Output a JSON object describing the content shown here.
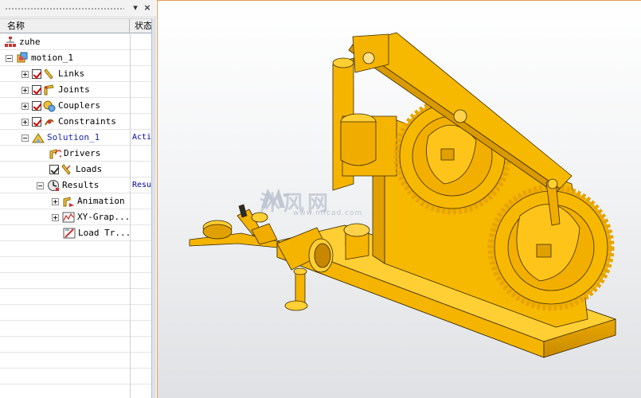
{
  "navigator": {
    "columns": {
      "name": "名称",
      "status": "状态"
    },
    "items": [
      {
        "label": "zuhe",
        "status": "",
        "icon": "assembly-icon"
      },
      {
        "label": "motion_1",
        "status": "",
        "icon": "motion-sim-icon"
      },
      {
        "label": "Links",
        "status": "",
        "icon": "links-icon"
      },
      {
        "label": "Joints",
        "status": "",
        "icon": "joints-icon"
      },
      {
        "label": "Couplers",
        "status": "",
        "icon": "couplers-icon"
      },
      {
        "label": "Constraints",
        "status": "",
        "icon": "constraints-icon"
      },
      {
        "label": "Solution_1",
        "status": "Active",
        "icon": "solution-icon"
      },
      {
        "label": "Drivers",
        "status": "",
        "icon": "drivers-icon"
      },
      {
        "label": "Loads",
        "status": "",
        "icon": "loads-icon"
      },
      {
        "label": "Results",
        "status": "Results",
        "icon": "results-icon"
      },
      {
        "label": "Animation",
        "status": "",
        "icon": "animation-icon"
      },
      {
        "label": "XY-Grap...",
        "status": "",
        "icon": "xy-graph-icon"
      },
      {
        "label": "Load Tr...",
        "status": "",
        "icon": "load-transfer-icon"
      }
    ]
  },
  "viewport": {
    "model_color": "#f5b400",
    "edge_color": "#3a2a00",
    "watermark_text": "沐风网",
    "watermark_url": "www.mfcad.com"
  }
}
